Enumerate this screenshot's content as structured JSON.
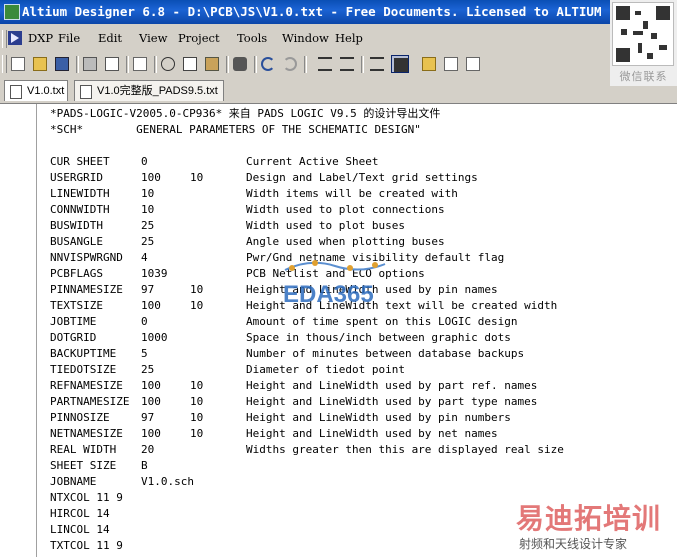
{
  "window": {
    "title": "Altium Designer 6.8 - D:\\PCB\\JS\\V1.0.txt - Free Documents. Licensed to ALTIUM"
  },
  "menubar": {
    "items": [
      "DXP",
      "File",
      "Edit",
      "View",
      "Project",
      "Tools",
      "Window",
      "Help"
    ]
  },
  "toolbar": {
    "buttons": [
      "new-file-icon",
      "open-folder-icon",
      "save-icon",
      "print-icon",
      "print-preview-icon",
      "page-icon",
      "cut-icon",
      "copy-icon",
      "paste-icon",
      "find-icon",
      "undo-icon",
      "redo-icon",
      "indent-icon",
      "outdent-icon",
      "list-icon",
      "table-icon",
      "arrow-icon",
      "document-icon",
      "project-icon"
    ]
  },
  "tabs": [
    {
      "label": "V1.0.txt"
    },
    {
      "label": "V1.0完整版_PADS9.5.txt"
    }
  ],
  "editor": {
    "lines": [
      {
        "c1": "*PADS-LOGIC-V2005.0-CP936* 来自 PADS LOGIC V9.5 的设计导出文件"
      },
      {
        "c1": "*SCH*        GENERAL PARAMETERS OF THE SCHEMATIC DESIGN\""
      },
      {
        "c1": ""
      },
      {
        "c1": "CUR SHEET",
        "c2": "0",
        "c3": "",
        "c4": "Current Active Sheet"
      },
      {
        "c1": "USERGRID",
        "c2": "100",
        "c3": "10",
        "c4": "Design and Label/Text grid settings"
      },
      {
        "c1": "LINEWIDTH",
        "c2": "10",
        "c3": "",
        "c4": "Width items will be created with"
      },
      {
        "c1": "CONNWIDTH",
        "c2": "10",
        "c3": "",
        "c4": "Width used to plot connections"
      },
      {
        "c1": "BUSWIDTH",
        "c2": "25",
        "c3": "",
        "c4": "Width used to plot buses"
      },
      {
        "c1": "BUSANGLE",
        "c2": "25",
        "c3": "",
        "c4": "Angle used when plotting buses"
      },
      {
        "c1": "NNVISPWRGND",
        "c2": "4",
        "c3": "",
        "c4": "Pwr/Gnd netname visibility default flag"
      },
      {
        "c1": "PCBFLAGS",
        "c2": "1039",
        "c3": "",
        "c4": "PCB Netlist and ECO options"
      },
      {
        "c1": "PINNAMESIZE",
        "c2": "97",
        "c3": "10",
        "c4": "Height and LineWidth used by pin names"
      },
      {
        "c1": "TEXTSIZE",
        "c2": "100",
        "c3": "10",
        "c4": "Height and LineWidth text will be created width"
      },
      {
        "c1": "JOBTIME",
        "c2": "0",
        "c3": "",
        "c4": "Amount of time spent on this LOGIC design"
      },
      {
        "c1": "DOTGRID",
        "c2": "1000",
        "c3": "",
        "c4": "Space in thous/inch between graphic dots"
      },
      {
        "c1": "BACKUPTIME",
        "c2": "5",
        "c3": "",
        "c4": "Number of minutes between database backups"
      },
      {
        "c1": "TIEDOTSIZE",
        "c2": "25",
        "c3": "",
        "c4": "Diameter of tiedot point"
      },
      {
        "c1": "REFNAMESIZE",
        "c2": "100",
        "c3": "10",
        "c4": "Height and LineWidth used by part ref. names"
      },
      {
        "c1": "PARTNAMESIZE",
        "c2": "100",
        "c3": "10",
        "c4": "Height and LineWidth used by part type names"
      },
      {
        "c1": "PINNOSIZE",
        "c2": "97",
        "c3": "10",
        "c4": "Height and LineWidth used by pin numbers"
      },
      {
        "c1": "NETNAMESIZE",
        "c2": "100",
        "c3": "10",
        "c4": "Height and LineWidth used by net names"
      },
      {
        "c1": "REAL WIDTH",
        "c2": "20",
        "c3": "",
        "c4": "Widths greater then this are displayed real size"
      },
      {
        "c1": "SHEET SIZE",
        "c2": "B",
        "c3": "",
        "c4": ""
      },
      {
        "c1": "JOBNAME",
        "c2": "V1.0.sch",
        "c3": "",
        "c4": ""
      },
      {
        "c1": "NTXCOL 11 9"
      },
      {
        "c1": "HIRCOL 14"
      },
      {
        "c1": "LINCOL 14"
      },
      {
        "c1": "TXTCOL 11 9"
      }
    ]
  },
  "watermarks": {
    "qr_caption": "微信联系",
    "eda": "EDA365",
    "cn_brand": "易迪拓培训",
    "cn_sub": "射频和天线设计专家"
  },
  "colors": {
    "title_bar": "#0b4ebd",
    "chrome": "#d4d0c8",
    "editor_bg": "#ffffff",
    "watermark_red": "#e06a6a",
    "watermark_blue": "#2d6dbf"
  }
}
